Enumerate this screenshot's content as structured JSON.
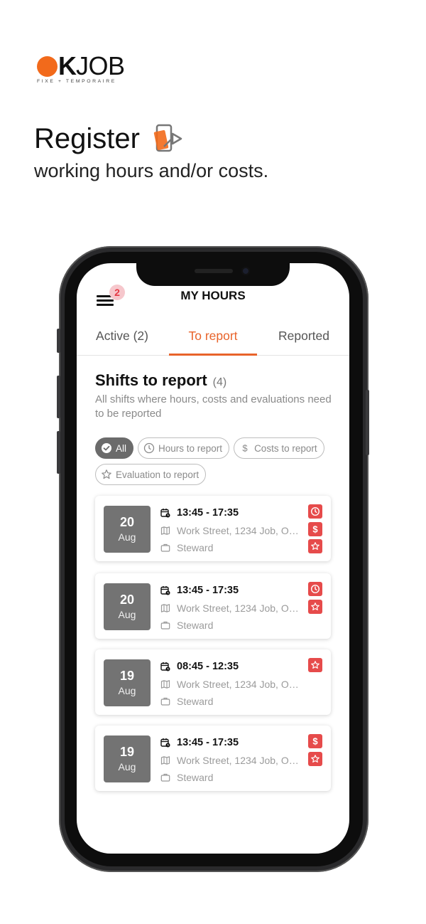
{
  "brand": {
    "logo_k": "K",
    "logo_job": "JOB",
    "tagline": "FIXE + TEMPORAIRE",
    "accent_color": "#f26a1b"
  },
  "hero": {
    "title": "Register",
    "subtitle": "working hours and/or costs.",
    "icon": "phone-tap-icon"
  },
  "app": {
    "title": "MY HOURS",
    "menu_badge": "2",
    "tabs": [
      {
        "label": "Active (2)",
        "active": false
      },
      {
        "label": "To report",
        "active": true
      },
      {
        "label": "Reported",
        "active": false
      }
    ],
    "section": {
      "title": "Shifts to report",
      "count": "(4)",
      "description": "All shifts where hours, costs and evaluations need to be reported"
    },
    "filters": [
      {
        "label": "All",
        "icon": "check-circle-icon",
        "active": true
      },
      {
        "label": "Hours to report",
        "icon": "clock-icon",
        "active": false
      },
      {
        "label": "Costs to report",
        "icon": "dollar-icon",
        "active": false
      },
      {
        "label": "Evaluation to report",
        "icon": "star-icon",
        "active": false
      }
    ],
    "shifts": [
      {
        "day": "20",
        "month": "Aug",
        "time": "13:45 - 17:35",
        "address": "Work Street, 1234 Job, Op...",
        "role": "Steward",
        "flags": [
          "clock-icon",
          "dollar-icon",
          "star-icon"
        ]
      },
      {
        "day": "20",
        "month": "Aug",
        "time": "13:45 - 17:35",
        "address": "Work Street, 1234 Job, Op...",
        "role": "Steward",
        "flags": [
          "clock-icon",
          "star-icon"
        ]
      },
      {
        "day": "19",
        "month": "Aug",
        "time": "08:45 - 12:35",
        "address": "Work Street, 1234 Job, Op...",
        "role": "Steward",
        "flags": [
          "star-icon"
        ]
      },
      {
        "day": "19",
        "month": "Aug",
        "time": "13:45 - 17:35",
        "address": "Work Street, 1234 Job, Op...",
        "role": "Steward",
        "flags": [
          "dollar-icon",
          "star-icon"
        ]
      }
    ],
    "colors": {
      "active_tab": "#e8632a",
      "flag": "#e64b4b",
      "date_box": "#737373"
    }
  }
}
